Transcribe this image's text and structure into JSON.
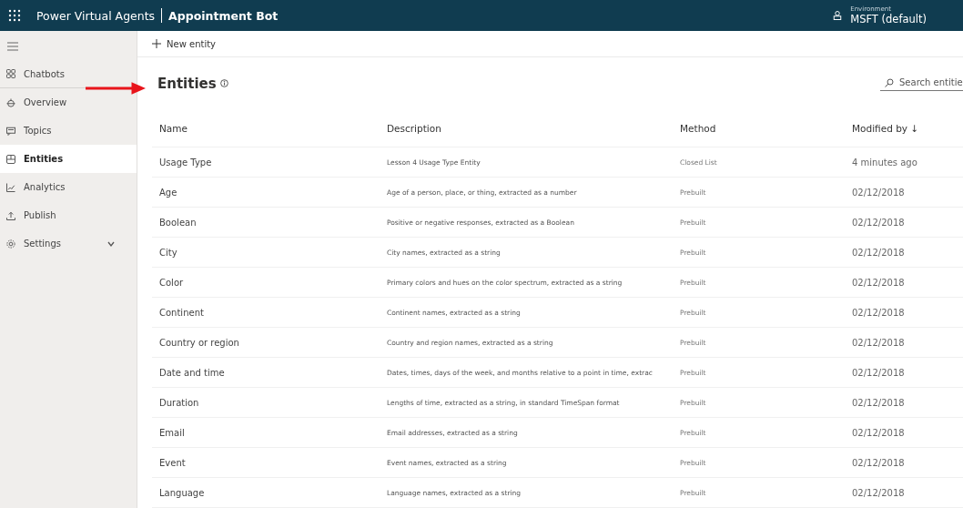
{
  "header": {
    "app_title": "Power Virtual Agents",
    "bot_name": "Appointment Bot",
    "environment_label": "Environment",
    "environment": "MSFT (default)"
  },
  "sidebar": {
    "items": [
      {
        "label": "Chatbots",
        "kind": "grid",
        "selected": false
      },
      {
        "label": "Overview",
        "kind": "bot",
        "selected": false
      },
      {
        "label": "Topics",
        "kind": "chat",
        "selected": false
      },
      {
        "label": "Entities",
        "kind": "entities",
        "selected": true
      },
      {
        "label": "Analytics",
        "kind": "chart",
        "selected": false
      },
      {
        "label": "Publish",
        "kind": "upload",
        "selected": false
      },
      {
        "label": "Settings",
        "kind": "gear",
        "selected": false,
        "expanded": false
      }
    ]
  },
  "command_bar": {
    "new_button": "New entity"
  },
  "page": {
    "title": "Entities",
    "search": {
      "placeholder": "Search entitie"
    }
  },
  "table": {
    "columns": [
      "Name",
      "Description",
      "Method",
      "Modified by ↓"
    ],
    "rows": [
      [
        "Usage Type",
        "Lesson 4 Usage Type Entity",
        "Closed List",
        "4 minutes ago"
      ],
      [
        "Age",
        "Age of a person, place, or thing, extracted as a number",
        "Prebuilt",
        "02/12/2018"
      ],
      [
        "Boolean",
        "Positive or negative responses, extracted as a Boolean",
        "Prebuilt",
        "02/12/2018"
      ],
      [
        "City",
        "City names, extracted as a string",
        "Prebuilt",
        "02/12/2018"
      ],
      [
        "Color",
        "Primary colors and hues on the color spectrum, extracted as a string",
        "Prebuilt",
        "02/12/2018"
      ],
      [
        "Continent",
        "Continent names, extracted as a string",
        "Prebuilt",
        "02/12/2018"
      ],
      [
        "Country or region",
        "Country and region names, extracted as a string",
        "Prebuilt",
        "02/12/2018"
      ],
      [
        "Date and time",
        "Dates, times, days of the week, and months relative to a point in time, extrac",
        "Prebuilt",
        "02/12/2018"
      ],
      [
        "Duration",
        "Lengths of time, extracted as a string, in standard TimeSpan format",
        "Prebuilt",
        "02/12/2018"
      ],
      [
        "Email",
        "Email addresses, extracted as a string",
        "Prebuilt",
        "02/12/2018"
      ],
      [
        "Event",
        "Event names, extracted as a string",
        "Prebuilt",
        "02/12/2018"
      ],
      [
        "Language",
        "Language names, extracted as a string",
        "Prebuilt",
        "02/12/2018"
      ]
    ]
  }
}
